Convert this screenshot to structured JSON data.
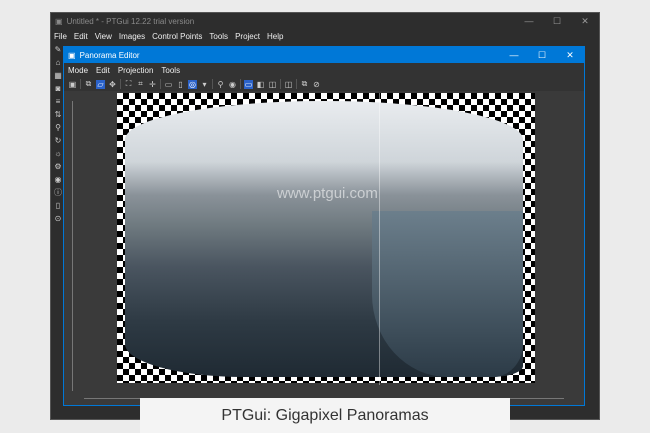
{
  "main_window": {
    "title": "Untitled * - PTGui 12.22 trial version",
    "menu": [
      "File",
      "Edit",
      "View",
      "Images",
      "Control Points",
      "Tools",
      "Project",
      "Help"
    ],
    "controls": [
      "—",
      "☐",
      "✕"
    ]
  },
  "sidebar_icons": [
    "✎",
    "⌂",
    "▦",
    "◙",
    "≡",
    "⇅",
    "⚲",
    "↻",
    "☼",
    "⚙",
    "◉",
    "ⓘ",
    "▯",
    "⊙"
  ],
  "editor": {
    "title": "Panorama Editor",
    "menu": [
      "Mode",
      "Edit",
      "Projection",
      "Tools"
    ],
    "controls": [
      "—",
      "☐",
      "✕"
    ],
    "toolbar": [
      "▣",
      "⧉",
      "▱",
      "✥",
      "⛶",
      "⌗",
      "✛",
      "▭",
      "▯",
      "◎",
      "▾",
      "⚲",
      "◉",
      "▭",
      "◧",
      "◫",
      "◫",
      "⧉",
      "⊘"
    ]
  },
  "watermark": "www.ptgui.com",
  "caption": "PTGui: Gigapixel Panoramas"
}
